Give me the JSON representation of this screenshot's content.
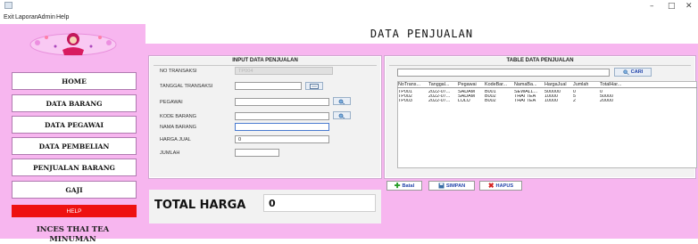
{
  "menu": {
    "items": [
      "Exit",
      "Laporan",
      "Admin",
      "Help"
    ]
  },
  "window_controls": {
    "minimize": "–",
    "maximize": "□",
    "close": "✕"
  },
  "sidebar": {
    "nav": [
      "HOME",
      "DATA BARANG",
      "DATA PEGAWAI",
      "DATA PEMBELIAN",
      "PENJUALAN BARANG",
      "GAJI"
    ],
    "help_label": "HELP",
    "brand_line1": "INCES THAI TEA",
    "brand_line2": "MINUMAN"
  },
  "header": {
    "title": "DATA PENJUALAN"
  },
  "input_panel": {
    "title": "INPUT DATA PENJUALAN",
    "labels": {
      "no_transaksi": "NO TRANSAKSI",
      "tanggal": "TANGGAL TRANSAKSI",
      "pegawai": "PEGAWAI",
      "kode_barang": "KODE BARANG",
      "nama_barang": "NAMA BARANG",
      "harga_jual": "HARGA JUAL",
      "jumlah": "JUMLAH"
    },
    "values": {
      "no_transaksi": "TP004",
      "tanggal": "",
      "pegawai": "",
      "kode_barang": "",
      "nama_barang": "",
      "harga_jual": "0",
      "jumlah": ""
    }
  },
  "table_panel": {
    "title": "TABLE DATA PENJUALAN",
    "search_value": "",
    "search_button": "CARI",
    "columns": [
      "NoTrans...",
      "Tanggal...",
      "Pegawai",
      "KodeBar...",
      "NamaBa...",
      "HargaJual",
      "Jumlah",
      "TotalHar..."
    ],
    "rows": [
      [
        "TP001",
        "2022-07...",
        "SADAM",
        "B001",
        "SEWALL...",
        "500000",
        "0",
        "0"
      ],
      [
        "TP002",
        "2022-07...",
        "SADAM",
        "B002",
        "THAI TEA",
        "10000",
        "5",
        "50000"
      ],
      [
        "TP003",
        "2022-07...",
        "LULU",
        "B002",
        "THAI TEA",
        "10000",
        "2",
        "20000"
      ]
    ]
  },
  "actions": {
    "batal": "Batal",
    "simpan": "SIMPAN",
    "hapus": "HAPUS"
  },
  "total": {
    "label": "TOTAL HARGA",
    "value": "0"
  },
  "colors": {
    "pink_bg": "#f7b6ef",
    "panel_bg": "#f2f2f2",
    "help_red": "#ee1111",
    "button_text": "#2244aa"
  }
}
